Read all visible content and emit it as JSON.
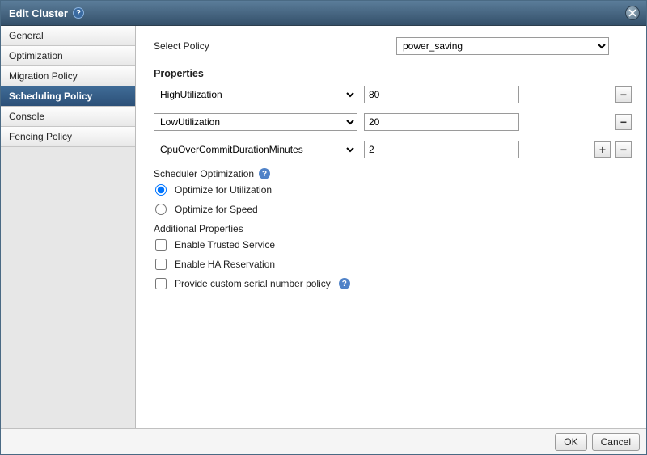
{
  "dialog": {
    "title": "Edit Cluster"
  },
  "sidebar": {
    "items": [
      {
        "label": "General"
      },
      {
        "label": "Optimization"
      },
      {
        "label": "Migration Policy"
      },
      {
        "label": "Scheduling Policy"
      },
      {
        "label": "Console"
      },
      {
        "label": "Fencing Policy"
      }
    ],
    "selected_index": 3
  },
  "policy": {
    "label": "Select Policy",
    "value": "power_saving"
  },
  "properties": {
    "heading": "Properties",
    "rows": [
      {
        "name": "HighUtilization",
        "value": "80",
        "show_add": false
      },
      {
        "name": "LowUtilization",
        "value": "20",
        "show_add": false
      },
      {
        "name": "CpuOverCommitDurationMinutes",
        "value": "2",
        "show_add": true
      }
    ],
    "plus": "+",
    "minus": "−"
  },
  "scheduler": {
    "heading": "Scheduler Optimization",
    "options": [
      {
        "label": "Optimize for Utilization",
        "checked": true
      },
      {
        "label": "Optimize for Speed",
        "checked": false
      }
    ]
  },
  "additional": {
    "heading": "Additional Properties",
    "checks": [
      {
        "label": "Enable Trusted Service",
        "checked": false,
        "help": false
      },
      {
        "label": "Enable HA Reservation",
        "checked": false,
        "help": false
      },
      {
        "label": "Provide custom serial number policy",
        "checked": false,
        "help": true
      }
    ]
  },
  "footer": {
    "ok": "OK",
    "cancel": "Cancel"
  }
}
